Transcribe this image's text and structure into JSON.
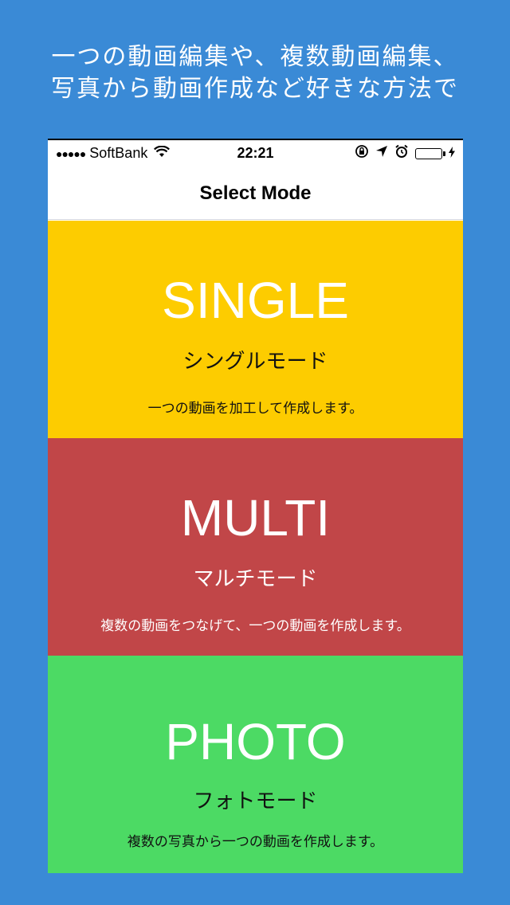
{
  "promo": {
    "line1": "一つの動画編集や、複数動画編集、",
    "line2": "写真から動画作成など好きな方法で"
  },
  "status_bar": {
    "signal_dots": "●●●●●",
    "carrier": "SoftBank",
    "time": "22:21",
    "battery_color": "#4cd964"
  },
  "nav": {
    "title": "Select Mode"
  },
  "modes": [
    {
      "title": "SINGLE",
      "subtitle": "シングルモード",
      "description": "一つの動画を加工して作成します。",
      "color": "#fdcc00"
    },
    {
      "title": "MULTI",
      "subtitle": "マルチモード",
      "description": "複数の動画をつなげて、一つの動画を作成します。",
      "color": "#c14648"
    },
    {
      "title": "PHOTO",
      "subtitle": "フォトモード",
      "description": "複数の写真から一つの動画を作成します。",
      "color": "#4cda64"
    }
  ],
  "colors": {
    "background": "#3a8ad6"
  }
}
